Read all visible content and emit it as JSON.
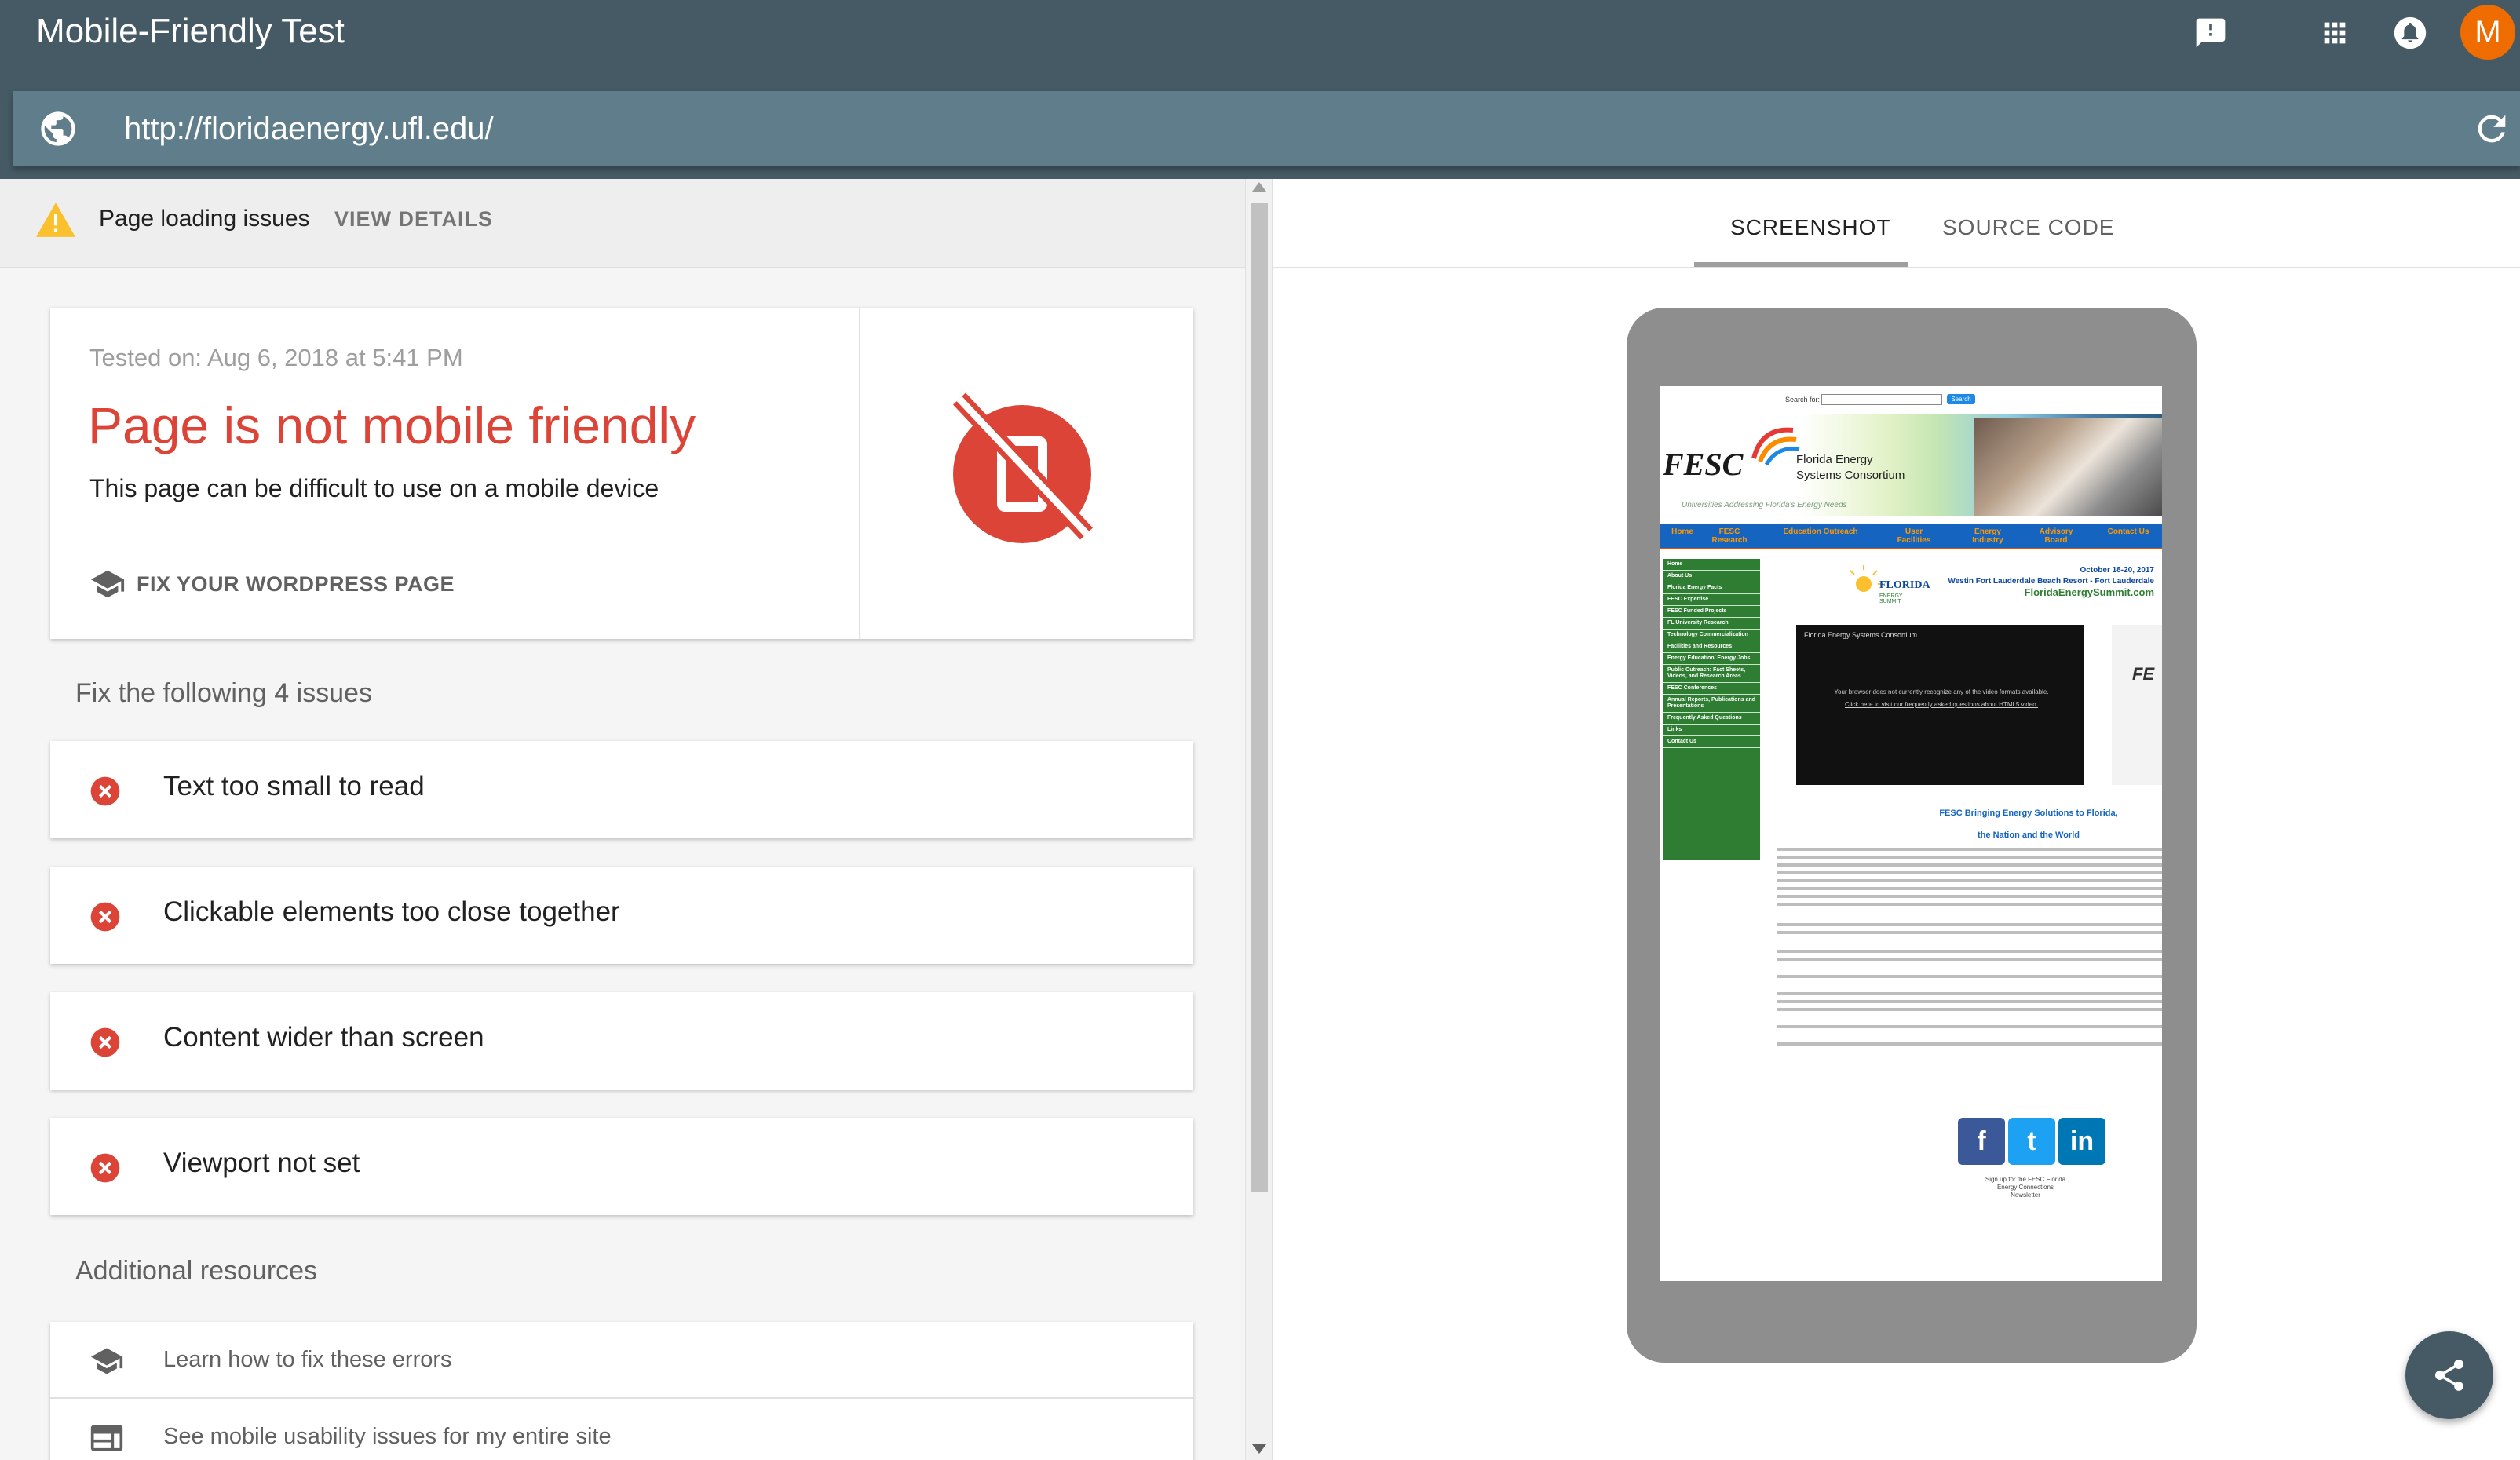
{
  "app": {
    "title": "Mobile-Friendly Test",
    "avatar_initial": "M",
    "avatar_color": "#ef6c00",
    "icons": [
      "feedback-icon",
      "apps-grid-icon",
      "notifications-icon"
    ]
  },
  "url_bar": {
    "url": "http://floridaenergy.ufl.edu/",
    "left_icon": "globe-icon",
    "right_icon": "reload-icon"
  },
  "warning": {
    "text": "Page loading issues",
    "link": "VIEW DETAILS",
    "icon": "warning-icon",
    "icon_color": "#fbc02d"
  },
  "result": {
    "tested_on": "Tested on: Aug 6, 2018 at 5:41 PM",
    "verdict": "Page is not mobile friendly",
    "verdict_color": "#db4437",
    "subtitle": "This page can be difficult to use on a mobile device",
    "fix_link": "FIX YOUR WORDPRESS PAGE",
    "badge_icon": "not-mobile-friendly-icon"
  },
  "issues": {
    "heading": "Fix the following 4 issues",
    "items": [
      {
        "label": "Text too small to read"
      },
      {
        "label": "Clickable elements too close together"
      },
      {
        "label": "Content wider than screen"
      },
      {
        "label": "Viewport not set"
      }
    ],
    "icon": "error-icon",
    "icon_color": "#db4437"
  },
  "resources": {
    "heading": "Additional resources",
    "items": [
      {
        "label": "Learn how to fix these errors",
        "icon": "school-icon"
      },
      {
        "label": "See mobile usability issues for my entire site",
        "icon": "web-icon"
      }
    ]
  },
  "preview_tabs": [
    {
      "label": "SCREENSHOT",
      "active": true
    },
    {
      "label": "SOURCE CODE",
      "active": false
    }
  ],
  "mini_site": {
    "search_label": "Search for:",
    "search_button": "Search",
    "logo": "FESC",
    "org_line1": "Florida Energy",
    "org_line2": "Systems Consortium",
    "tagline": "Universities Addressing Florida's Energy Needs",
    "nav": [
      "Home",
      "FESC Research",
      "Education Outreach",
      "User Facilities",
      "Energy Industry",
      "Advisory Board",
      "Contact Us"
    ],
    "sidebar": [
      "Home",
      "About Us",
      "Florida Energy Facts",
      "FESC Expertise",
      "FESC Funded Projects",
      "FL University Research",
      "Technology Commercialization",
      "Facilities and Resources",
      "Energy Education/ Energy Jobs",
      "Public Outreach: Fact Sheets, Videos, and Research Areas",
      "FESC Conferences",
      "Annual Reports, Publications and Presentations",
      "Frequently Asked Questions",
      "Links",
      "Contact Us"
    ],
    "summit_date": "October 18-20, 2017",
    "summit_place": "Westin Fort Lauderdale Beach Resort - Fort Lauderdale",
    "summit_site": "FloridaEnergySummit.com",
    "summit_logo_top": "FLORIDA",
    "summit_logo_bottom": "ENERGY SUMMIT",
    "video_title": "Florida Energy Systems Consortium",
    "video_msg": "Your browser does not currently recognize any of the video formats available.",
    "video_link": "Click here to visit our frequently asked questions about HTML5 video.",
    "fe_text": "FE",
    "heading_line1": "FESC Bringing Energy Solutions to Florida,",
    "heading_line2": "the Nation and the World",
    "social": [
      "f",
      "t",
      "in"
    ],
    "signup": "Sign up for the FESC Florida Energy Connections Newsletter"
  }
}
